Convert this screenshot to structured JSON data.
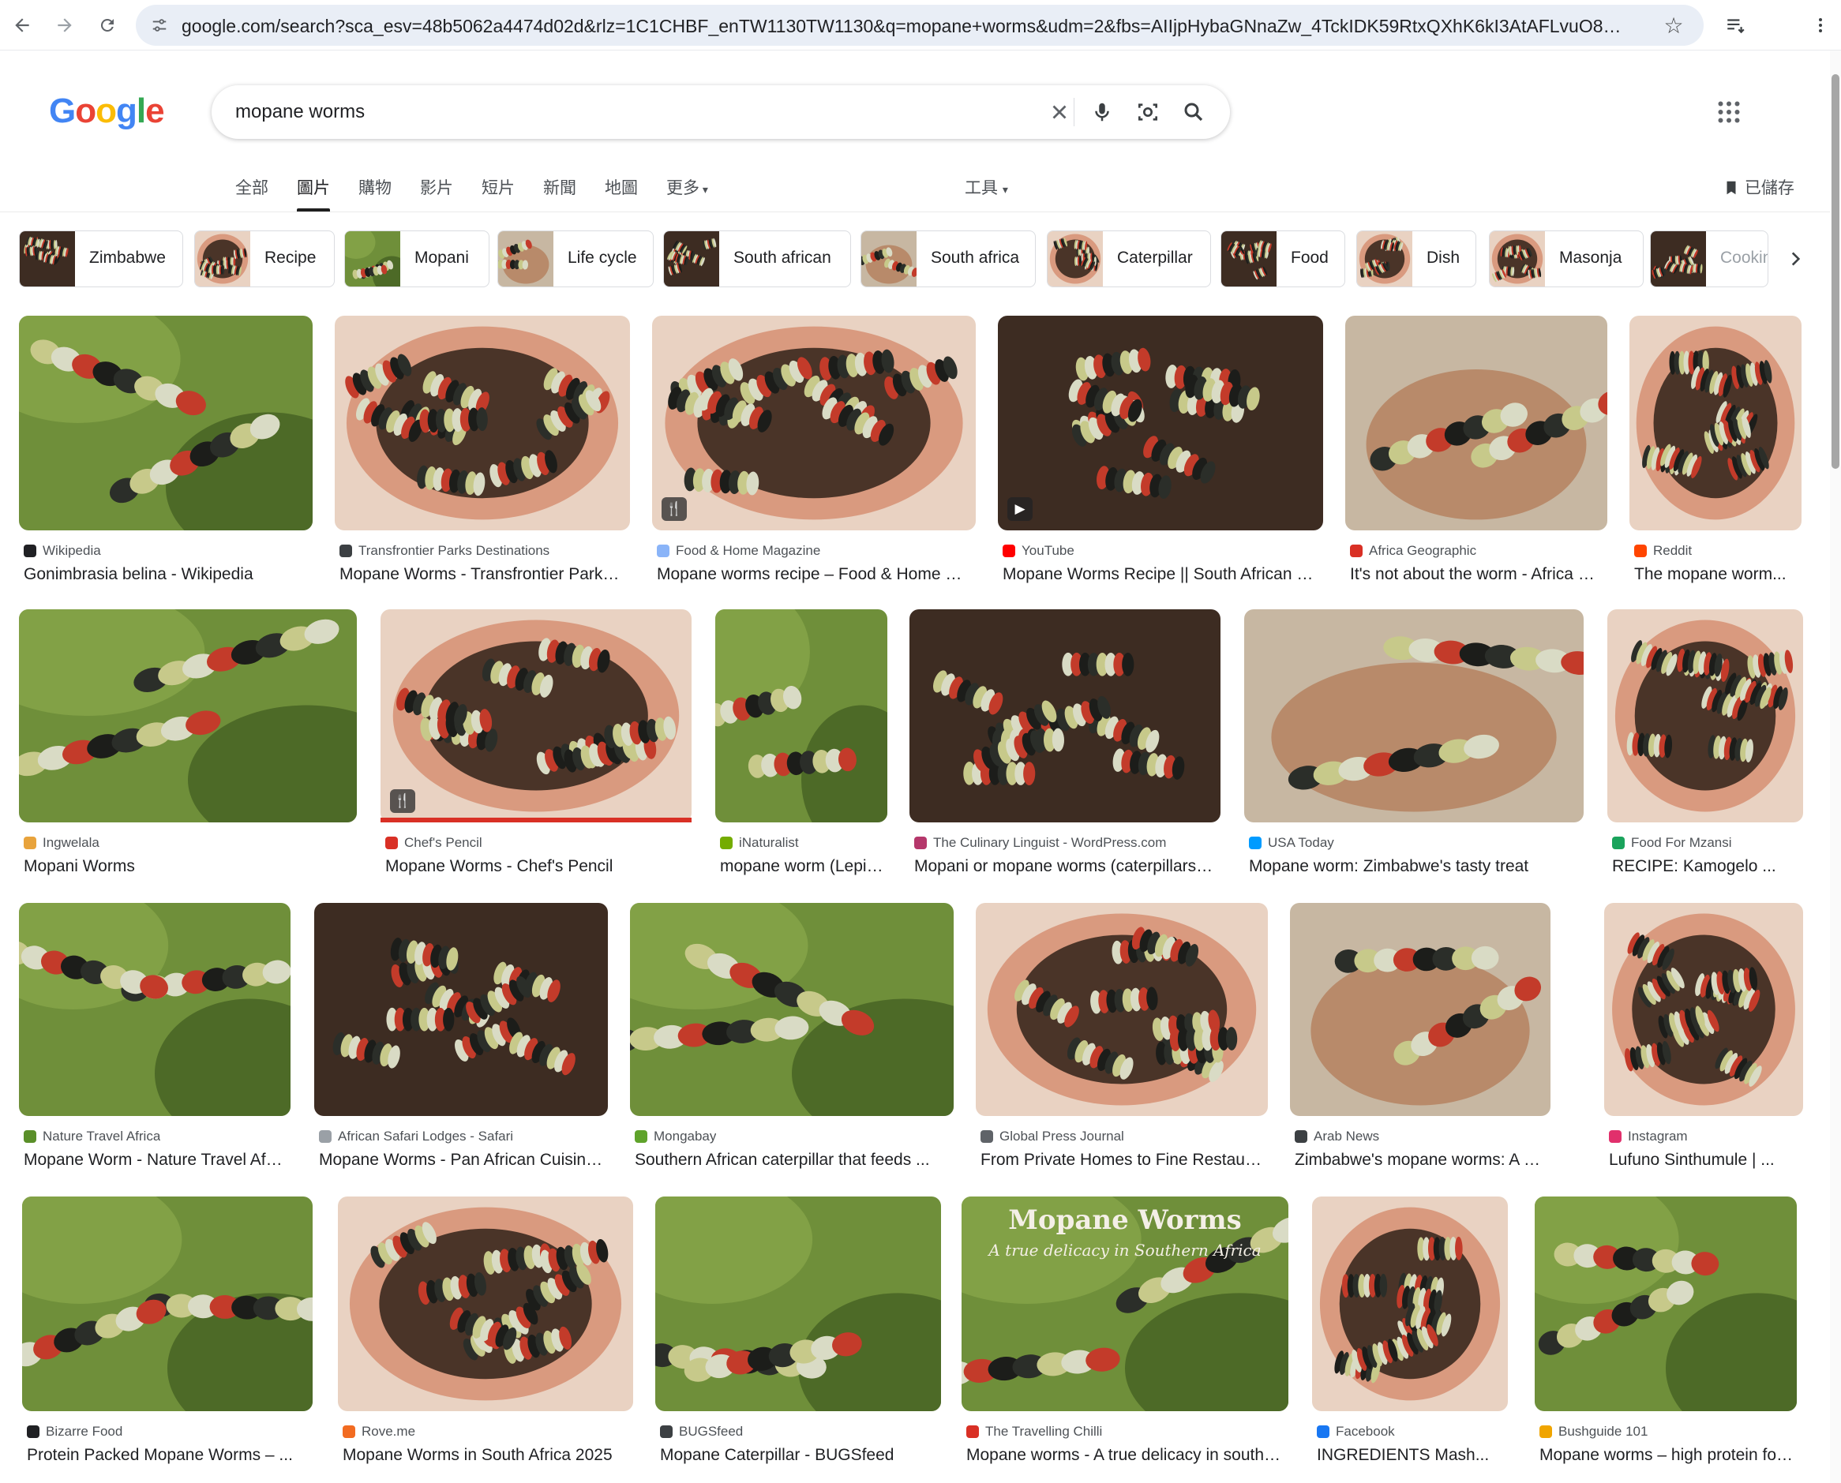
{
  "browser": {
    "url": "google.com/search?sca_esv=48b5062a4474d02d&rlz=1C1CHBF_enTW1130TW1130&q=mopane+worms&udm=2&fbs=AIIjpHybaGNnaZw_4TckIDK59RtxQXhK6kI3AtAFLvuO8MTsf1dhP..."
  },
  "logo": [
    "G",
    "o",
    "o",
    "g",
    "l",
    "e"
  ],
  "logo_colors": [
    "#4285f4",
    "#ea4335",
    "#fbbc05",
    "#4285f4",
    "#34a853",
    "#ea4335"
  ],
  "search": {
    "query": "mopane worms"
  },
  "tabs": [
    {
      "label": "全部",
      "active": false
    },
    {
      "label": "圖片",
      "active": true
    },
    {
      "label": "購物",
      "active": false
    },
    {
      "label": "影片",
      "active": false
    },
    {
      "label": "短片",
      "active": false
    },
    {
      "label": "新聞",
      "active": false
    },
    {
      "label": "地圖",
      "active": false
    },
    {
      "label": "更多",
      "active": false
    }
  ],
  "tools_label": "工具",
  "saved_label": "已儲存",
  "chips": [
    {
      "label": "Zimbabwe"
    },
    {
      "label": "Recipe"
    },
    {
      "label": "Mopani"
    },
    {
      "label": "Life cycle"
    },
    {
      "label": "South african"
    },
    {
      "label": "South africa"
    },
    {
      "label": "Caterpillar"
    },
    {
      "label": "Food"
    },
    {
      "label": "Dish"
    },
    {
      "label": "Masonja"
    },
    {
      "label": "Cookin"
    }
  ],
  "colors": {
    "caterpillar": [
      "#2b2e29",
      "#c7c98a",
      "#d9dbc5",
      "#c33b2a",
      "#1c1d1a"
    ],
    "leaf": "#5b7f2c",
    "dish": "#4a3428"
  },
  "results": [
    {
      "source": "Wikipedia",
      "title": "Gonimbrasia belina - Wikipedia",
      "badge": "",
      "fav": "#202124"
    },
    {
      "source": "Transfrontier Parks Destinations",
      "title": "Mopane Worms - Transfrontier Parks Destinations",
      "badge": "",
      "fav": "#3c4043"
    },
    {
      "source": "Food & Home Magazine",
      "title": "Mopane worms recipe – Food & Home Magazine",
      "badge": "recipe",
      "fav": "#8ab4f8"
    },
    {
      "source": "YouTube",
      "title": "Mopane Worms Recipe || South African Food",
      "badge": "video",
      "fav": "#ff0000"
    },
    {
      "source": "Africa Geographic",
      "title": "It's not about the worm - Africa Geographic",
      "badge": "",
      "fav": "#d93025"
    },
    {
      "source": "Reddit",
      "title": "The mopane worm...",
      "badge": "",
      "fav": "#ff4500"
    },
    {
      "source": "Ingwelala",
      "title": "Mopani Worms",
      "badge": "",
      "fav": "#e8a33c"
    },
    {
      "source": "Chef's Pencil",
      "title": "Mopane Worms - Chef's Pencil",
      "badge": "recipe",
      "fav": "#d93025"
    },
    {
      "source": "iNaturalist",
      "title": "mopane worm (Lepidoptera)",
      "badge": "",
      "fav": "#74ac00"
    },
    {
      "source": "The Culinary Linguist - WordPress.com",
      "title": "Mopani or mopane worms (caterpillars) ...",
      "badge": "",
      "fav": "#b5376b"
    },
    {
      "source": "USA Today",
      "title": "Mopane worm: Zimbabwe's tasty treat",
      "badge": "",
      "fav": "#009bff"
    },
    {
      "source": "Food For Mzansi",
      "title": "RECIPE: Kamogelo ...",
      "badge": "",
      "fav": "#1aa35c"
    },
    {
      "source": "Nature Travel Africa",
      "title": "Mopane Worm - Nature Travel Africa",
      "badge": "",
      "fav": "#5a8f29"
    },
    {
      "source": "African Safari Lodges - Safari",
      "title": "Mopane Worms - Pan African Cuisine ...",
      "badge": "",
      "fav": "#9aa0a6"
    },
    {
      "source": "Mongabay",
      "title": "Southern African caterpillar that feeds ...",
      "badge": "",
      "fav": "#5fa32b"
    },
    {
      "source": "Global Press Journal",
      "title": "From Private Homes to Fine Restaurants ...",
      "badge": "",
      "fav": "#5f6368"
    },
    {
      "source": "Arab News",
      "title": "Zimbabwe's mopane worms: A dietary ...",
      "badge": "",
      "fav": "#3c4043"
    },
    {
      "source": "Instagram",
      "title": "Lufuno Sinthumule | ...",
      "badge": "",
      "fav": "#e1306c"
    },
    {
      "source": "Bizarre Food",
      "title": "Protein Packed Mopane Worms – ...",
      "badge": "",
      "fav": "#202124"
    },
    {
      "source": "Rove.me",
      "title": "Mopane Worms in South Africa 2025",
      "badge": "",
      "fav": "#f26b21"
    },
    {
      "source": "BUGSfeed",
      "title": "Mopane Caterpillar - BUGSfeed",
      "badge": "",
      "fav": "#3c4043"
    },
    {
      "source": "The Travelling Chilli",
      "title": "Mopane worms - A true delicacy in southern Africa",
      "badge": "",
      "fav": "#d93025"
    },
    {
      "source": "Facebook",
      "title": "INGREDIENTS Mash...",
      "badge": "",
      "fav": "#1877f2"
    },
    {
      "source": "Bushguide 101",
      "title": "Mopane worms – high protein food ...",
      "badge": "",
      "fav": "#f0a500"
    }
  ],
  "overlay_text": {
    "title": "Mopane Worms",
    "subtitle": "A true delicacy in Southern Africa"
  }
}
